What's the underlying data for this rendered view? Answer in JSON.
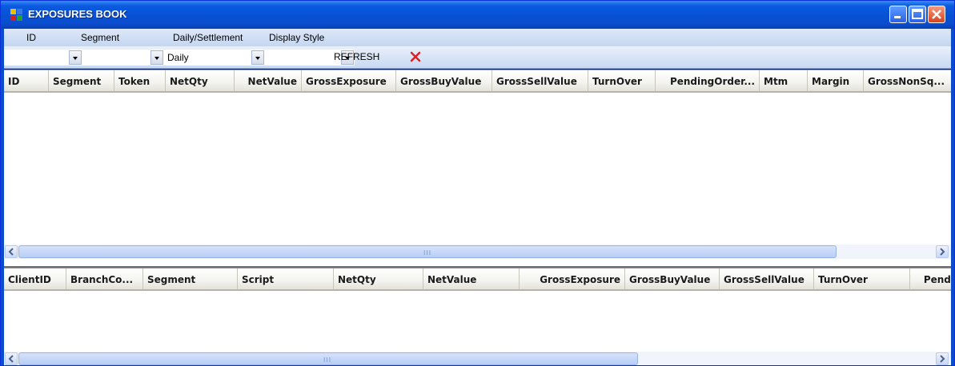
{
  "window": {
    "title": "EXPOSURES BOOK"
  },
  "filter_labels": [
    "ID",
    "Segment",
    "Daily/Settlement",
    "Display Style"
  ],
  "toolbar": {
    "id_combo": "",
    "segment_combo": "",
    "daily_combo": "Daily",
    "display_combo": "",
    "refresh_label": "REFRESH",
    "clear_icon": "red-x-icon"
  },
  "grid_top": {
    "columns": [
      "ID",
      "Segment",
      "Token",
      "NetQty",
      "NetValue",
      "GrossExposure",
      "GrossBuyValue",
      "GrossSellValue",
      "TurnOver",
      "PendingOrder...",
      "Mtm",
      "Margin",
      "GrossNonSq..."
    ],
    "scroll_grip": "III"
  },
  "grid_bottom": {
    "columns": [
      "ClientID",
      "BranchCo...",
      "Segment",
      "Script",
      "NetQty",
      "NetValue",
      "GrossExposure",
      "GrossBuyValue",
      "GrossSellValue",
      "TurnOver",
      "Pendi"
    ],
    "scroll_grip": "III"
  },
  "colors": {
    "title_bar": "#0852d6",
    "toolbar": "#c8d9f2",
    "close_button": "#d9441d",
    "clear_icon": "#e02020"
  }
}
